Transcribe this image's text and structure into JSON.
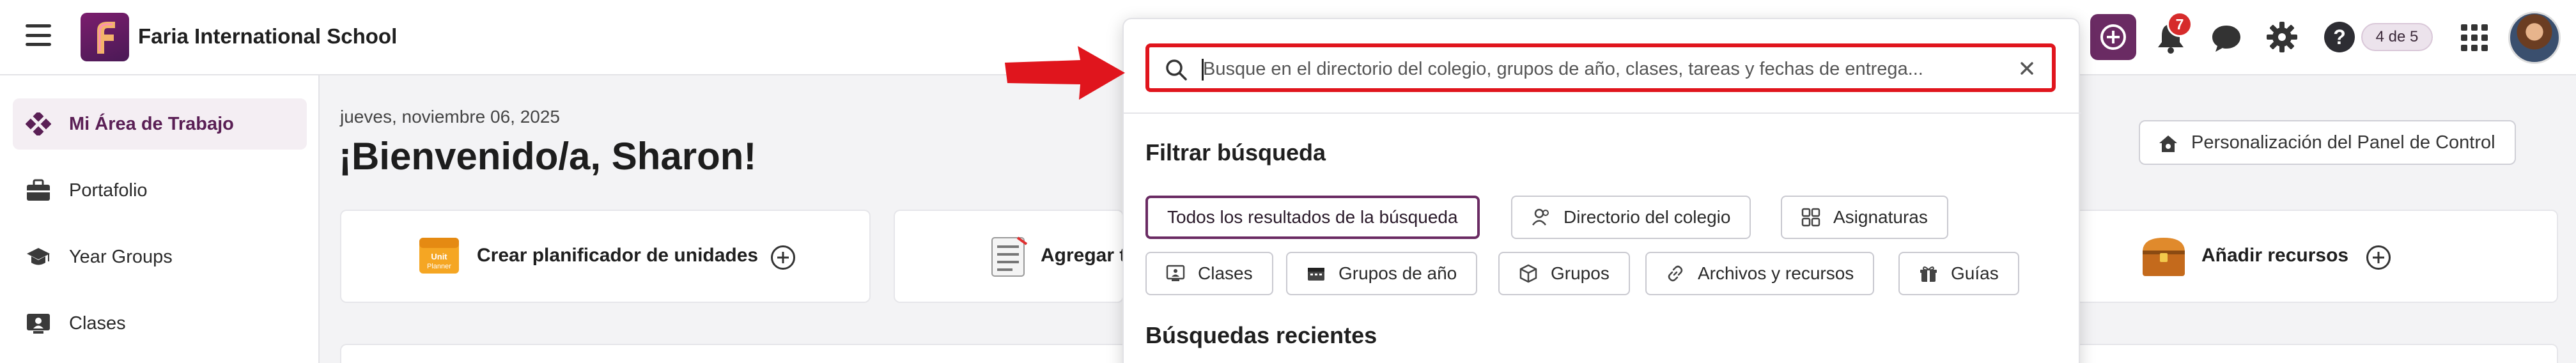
{
  "header": {
    "school_name": "Faria International School",
    "notification_count": "7",
    "steps_label": "4 de 5"
  },
  "sidebar": {
    "items": [
      {
        "label": "Mi Área de Trabajo",
        "icon": "workspace-diamond-icon",
        "active": true
      },
      {
        "label": "Portafolio",
        "icon": "briefcase-icon",
        "active": false
      },
      {
        "label": "Year Groups",
        "icon": "graduation-cap-icon",
        "active": false
      },
      {
        "label": "Clases",
        "icon": "class-board-icon",
        "active": false
      }
    ]
  },
  "main": {
    "date": "jueves, noviembre 06, 2025",
    "welcome": "¡Bienvenido/a, Sharon!",
    "customize_button": "Personalización del Panel de Control",
    "cards": [
      {
        "label": "Crear planificador de unidades",
        "icon": "unit-planner-icon"
      },
      {
        "label": "Agregar t",
        "icon": "task-list-icon"
      },
      {
        "label": "Añadir recursos",
        "icon": "treasure-chest-icon"
      }
    ]
  },
  "search": {
    "placeholder": "Busque en el directorio del colegio, grupos de año, clases, tareas y fechas de entrega...",
    "filter_title": "Filtrar búsqueda",
    "recent_title": "Búsquedas recientes",
    "filters": [
      {
        "label": "Todos los resultados de la búsqueda",
        "selected": true,
        "icon": ""
      },
      {
        "label": "Directorio del colegio",
        "selected": false,
        "icon": "people-icon"
      },
      {
        "label": "Asignaturas",
        "selected": false,
        "icon": "grid-icon"
      },
      {
        "label": "Clases",
        "selected": false,
        "icon": "class-board-icon"
      },
      {
        "label": "Grupos de año",
        "selected": false,
        "icon": "calendar-icon"
      },
      {
        "label": "Grupos",
        "selected": false,
        "icon": "cube-icon"
      },
      {
        "label": "Archivos y recursos",
        "selected": false,
        "icon": "link-icon"
      },
      {
        "label": "Guías",
        "selected": false,
        "icon": "gift-icon"
      }
    ]
  },
  "colors": {
    "brand": "#6a2b63",
    "highlight_border": "#e0151d",
    "badge": "#d62b2b"
  }
}
